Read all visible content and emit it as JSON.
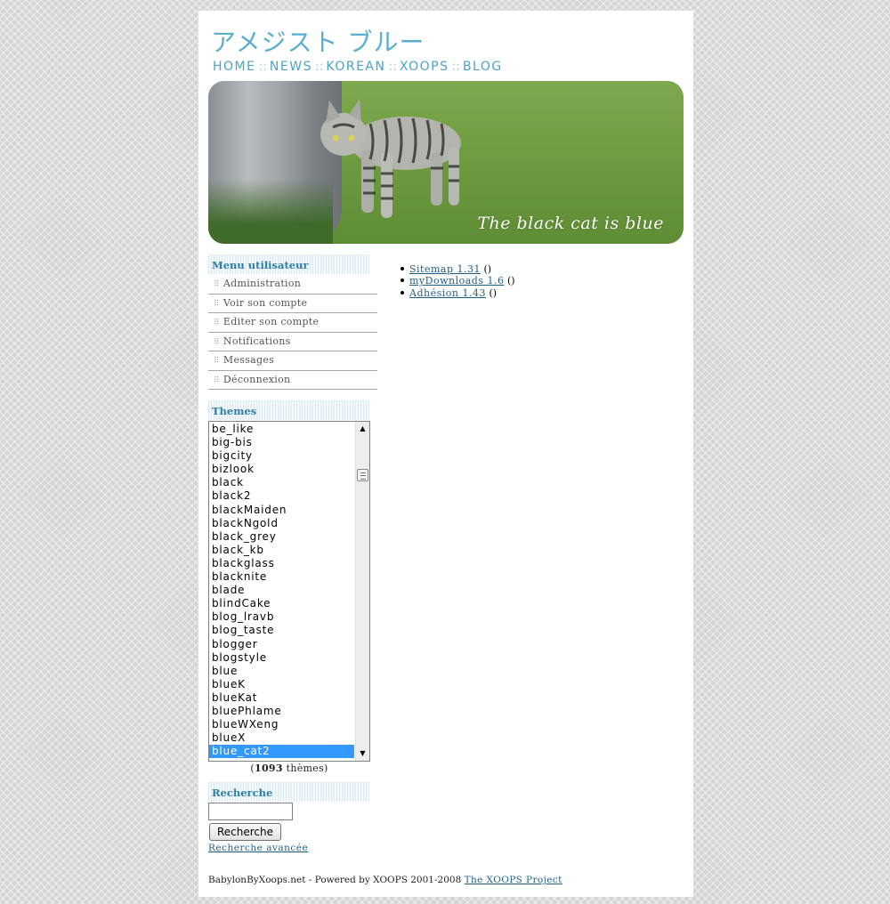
{
  "header": {
    "site_title": "アメジスト ブルー",
    "nav": [
      {
        "label": "HOME"
      },
      {
        "label": "NEWS"
      },
      {
        "label": "KOREAN"
      },
      {
        "label": "XOOPS"
      },
      {
        "label": "BLOG"
      }
    ],
    "nav_separator": "::"
  },
  "banner": {
    "caption": "The black cat is blue"
  },
  "user_menu": {
    "title": "Menu utilisateur",
    "items": [
      {
        "label": "Administration"
      },
      {
        "label": "Voir son compte"
      },
      {
        "label": "Editer son compte"
      },
      {
        "label": "Notifications"
      },
      {
        "label": "Messages"
      },
      {
        "label": "Déconnexion"
      }
    ]
  },
  "themes": {
    "title": "Themes",
    "options": [
      "be_like",
      "big-bis",
      "bigcity",
      "bizlook",
      "black",
      "black2",
      "blackMaiden",
      "blackNgold",
      "black_grey",
      "black_kb",
      "blackglass",
      "blacknite",
      "blade",
      "blindCake",
      "blog_lravb",
      "blog_taste",
      "blogger",
      "blogstyle",
      "blue",
      "blueK",
      "blueKat",
      "bluePhlame",
      "blueWXeng",
      "blueX",
      "blue_cat2"
    ],
    "selected": "blue_cat2",
    "count": "1093",
    "count_label": "thèmes"
  },
  "search": {
    "title": "Recherche",
    "input_value": "",
    "button_label": "Recherche",
    "advanced_label": "Recherche avancée"
  },
  "modules": [
    {
      "label": "Sitemap 1.31",
      "suffix": "()"
    },
    {
      "label": "myDownloads 1.6",
      "suffix": "()"
    },
    {
      "label": "Adhésion 1.43",
      "suffix": "()"
    }
  ],
  "footer": {
    "text": "BabylonByXoops.net - Powered by XOOPS 2001-2008",
    "link": "The XOOPS Project"
  },
  "colors": {
    "accent": "#5aaed0",
    "link": "#1f5f86",
    "block_title": "#2d7fa7",
    "selection": "#3399ff"
  }
}
